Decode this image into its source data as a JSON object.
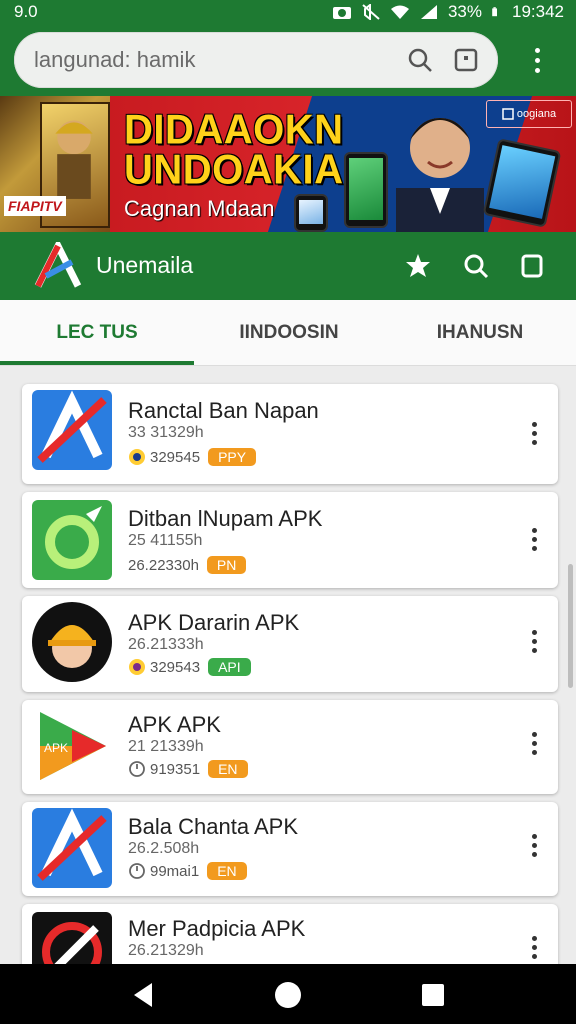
{
  "status_bar": {
    "time_left": "9.0",
    "battery": "33%",
    "clock": "19:342"
  },
  "browser": {
    "url_text": "langunad: hamik",
    "search_icon": "search-icon",
    "tab_icon": "tab-switcher-icon",
    "menu_icon": "overflow-menu-icon"
  },
  "banner": {
    "title_line1": "DIDAAOKN",
    "title_line2": "UNDOAKIA",
    "subtitle": "Cagnan Mdaan",
    "box_label": "FIAPITV",
    "brand_tag": "oogiana"
  },
  "app_header": {
    "title": "Unemaila",
    "icons": [
      "star-icon",
      "search-icon",
      "bookmark-icon"
    ]
  },
  "tabs": [
    {
      "label": "LEC TUS",
      "active": true
    },
    {
      "label": "IINDOOSIN",
      "active": false
    },
    {
      "label": "IHANUSN",
      "active": false
    }
  ],
  "apps": [
    {
      "name": "Ranctal Ban Napan",
      "sub": "33 31329h",
      "meta": "329545",
      "badge": "PPY",
      "badge_color": "#f29a1e"
    },
    {
      "name": "Ditban lNupam APK",
      "sub": "25 41155h",
      "meta": "26.22330h",
      "badge": "PN",
      "badge_color": "#f29a1e"
    },
    {
      "name": "APK Dararin APK",
      "sub": "26.21333h",
      "meta": "329543",
      "badge": "API",
      "badge_color": "#3aab4a"
    },
    {
      "name": "APK APK",
      "sub": "21 21339h",
      "meta": "919351",
      "badge": "EN",
      "badge_color": "#f29a1e"
    },
    {
      "name": "Bala Chanta APK",
      "sub": "26.2.508h",
      "meta": "99mai1",
      "badge": "EN",
      "badge_color": "#f29a1e"
    },
    {
      "name": "Mer Padpicia APK",
      "sub": "26.21329h",
      "meta": "",
      "badge": "",
      "badge_color": ""
    }
  ],
  "colors": {
    "primary_green": "#1e7a32",
    "banner_red": "#d8242a",
    "badge_orange": "#f29a1e",
    "badge_green": "#3aab4a"
  }
}
